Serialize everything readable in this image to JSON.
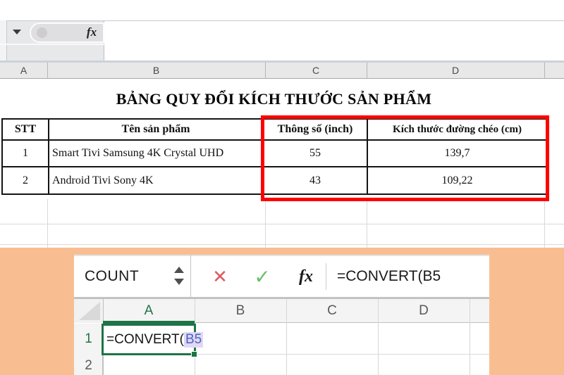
{
  "top_sheet": {
    "formula_bar": {
      "fx_label": "fx"
    },
    "column_headers": [
      "A",
      "B",
      "C",
      "D"
    ],
    "title": "BẢNG QUY ĐỔI KÍCH THƯỚC SẢN PHẨM",
    "table": {
      "headers": [
        "STT",
        "Tên sản phẩm",
        "Thông số (inch)",
        "Kích thước đường chéo (cm)"
      ],
      "rows": [
        {
          "stt": "1",
          "name": "Smart Tivi Samsung 4K Crystal UHD",
          "inch": "55",
          "cm": "139,7"
        },
        {
          "stt": "2",
          "name": "Android Tivi Sony 4K",
          "inch": "43",
          "cm": "109,22"
        }
      ]
    },
    "highlight_color": "#fe0000"
  },
  "bottom_sheet": {
    "name_box": {
      "value": "COUNT"
    },
    "formula_bar": {
      "cancel_icon": "✕",
      "enter_icon": "✓",
      "fx_label": "fx",
      "formula": "=CONVERT(B5"
    },
    "column_headers": [
      "A",
      "B",
      "C",
      "D"
    ],
    "row_headers": [
      "1",
      "2"
    ],
    "active_cell": {
      "ref": "A1",
      "text_prefix": "=CONVERT(",
      "text_ref": "B5"
    },
    "colors": {
      "accent_green": "#217346",
      "ref_blue": "#4567c8",
      "ref_highlight": "#e3d7f3",
      "cancel_red": "#dd5a5e",
      "enter_green": "#69be69",
      "background_orange": "#f8be92"
    }
  }
}
